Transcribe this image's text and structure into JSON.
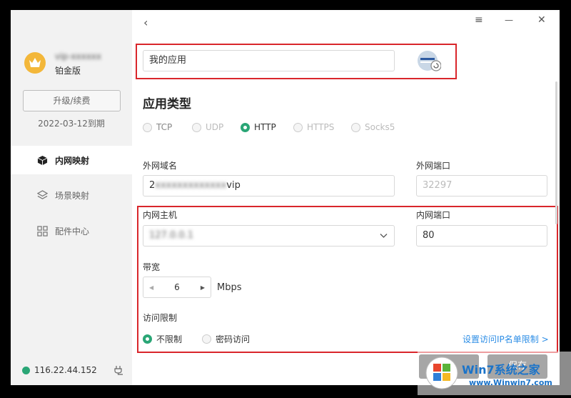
{
  "sidebar": {
    "username": "vip-xxxxxx",
    "tier": "铂金版",
    "upgrade_label": "升级/续费",
    "expire": "2022-03-12到期",
    "items": [
      {
        "label": "内网映射",
        "icon": "cube-icon",
        "active": true
      },
      {
        "label": "场景映射",
        "icon": "scene-icon",
        "active": false
      },
      {
        "label": "配件中心",
        "icon": "grid-icon",
        "active": false
      }
    ],
    "ip": "116.22.44.152"
  },
  "header": {
    "back_icon": "‹",
    "menu_icon": "≡",
    "min_icon": "—",
    "close_icon": "✕"
  },
  "app": {
    "name_value": "我的应用"
  },
  "app_type": {
    "title": "应用类型",
    "options": [
      "TCP",
      "UDP",
      "HTTP",
      "HTTPS",
      "Socks5"
    ],
    "selected": "HTTP"
  },
  "external": {
    "domain_label": "外网域名",
    "domain_prefix": "2",
    "domain_hidden": "xxxxxxxxxxxxx",
    "domain_suffix": "vip",
    "port_label": "外网端口",
    "port_value": "32297"
  },
  "internal": {
    "host_label": "内网主机",
    "host_value": "127.0.0.1",
    "port_label": "内网端口",
    "port_value": "80"
  },
  "bandwidth": {
    "label": "带宽",
    "value": "6",
    "unit": "Mbps"
  },
  "access": {
    "label": "访问限制",
    "options": [
      "不限制",
      "密码访问"
    ],
    "selected": "不限制",
    "link": "设置访问IP名单限制 >"
  },
  "footer": {
    "save_label": "保存"
  },
  "watermark": {
    "brand": "Win7系统之家",
    "url": "www.Winwin7.com"
  },
  "colors": {
    "accent": "#2aa676",
    "highlight": "#d9262b",
    "link": "#2d8ee6"
  }
}
